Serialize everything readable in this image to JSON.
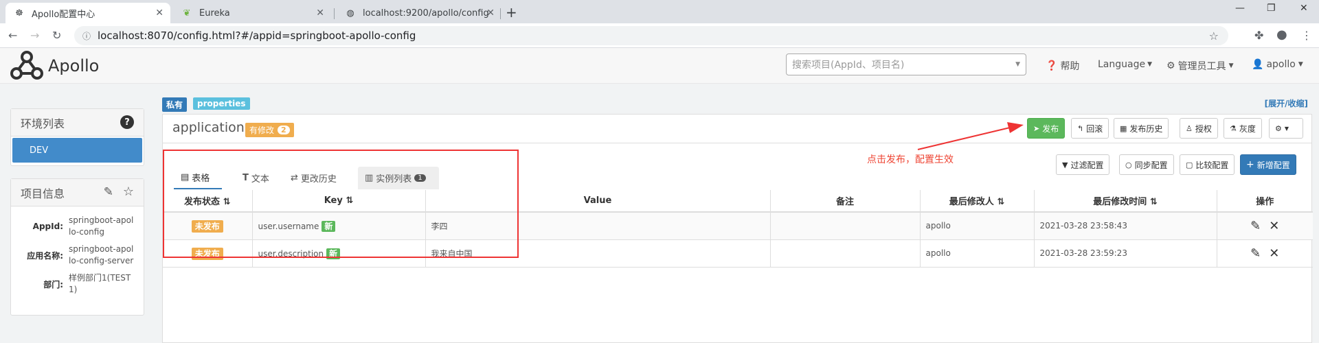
{
  "browser": {
    "tabs": [
      {
        "title": "Apollo配置中心",
        "active": true
      },
      {
        "title": "Eureka",
        "active": false
      },
      {
        "title": "localhost:9200/apollo/config",
        "active": false
      }
    ],
    "url": "localhost:8070/config.html?#/appid=springboot-apollo-config"
  },
  "header": {
    "logo_text": "Apollo",
    "search_placeholder": "搜索项目(AppId、项目名)",
    "help": "帮助",
    "language": "Language",
    "admin_tools": "管理员工具",
    "user": "apollo"
  },
  "sidebar": {
    "env_title": "环境列表",
    "envs": [
      "DEV"
    ],
    "project_title": "项目信息",
    "info": [
      {
        "key": "AppId:",
        "value": "springboot-apollo-config"
      },
      {
        "key": "应用名称:",
        "value": "springboot-apollo-config-server"
      },
      {
        "key": "部门:",
        "value": "样例部门1(TEST1)"
      }
    ]
  },
  "namespace": {
    "badge_private": "私有",
    "badge_format": "properties",
    "toggle": "[展开/收缩]",
    "title": "application",
    "modified_label": "有修改",
    "modified_count": "2",
    "buttons": {
      "publish": "发布",
      "rollback": "回滚",
      "history": "发布历史",
      "grant": "授权",
      "gray": "灰度"
    },
    "toolbar": {
      "filter": "过滤配置",
      "sync": "同步配置",
      "compare": "比较配置",
      "add": "新增配置"
    },
    "annotation": "点击发布，配置生效",
    "tabs": [
      "表格",
      "文本",
      "更改历史",
      "实例列表"
    ],
    "instance_count": "1",
    "columns": [
      "发布状态",
      "Key",
      "Value",
      "备注",
      "最后修改人",
      "最后修改时间",
      "操作"
    ],
    "rows": [
      {
        "status": "未发布",
        "key": "user.username",
        "new": "新",
        "value": "李四",
        "comment": "",
        "modifier": "apollo",
        "time": "2021-03-28 23:58:43"
      },
      {
        "status": "未发布",
        "key": "user.description",
        "new": "新",
        "value": "我来自中国",
        "comment": "",
        "modifier": "apollo",
        "time": "2021-03-28 23:59:23"
      }
    ]
  }
}
